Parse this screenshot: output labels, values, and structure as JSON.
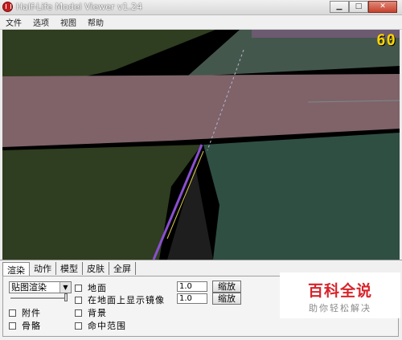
{
  "window": {
    "title": "Half-Life Model Viewer v1.24",
    "controls": {
      "minimize": "▁",
      "maximize": "□",
      "close": "✕"
    }
  },
  "menu": [
    "文件",
    "选项",
    "视图",
    "帮助"
  ],
  "viewport": {
    "fps": "60",
    "colors": {
      "background": "#000000",
      "green_dark": "#2f3d20",
      "pink": "#7f6369",
      "teal": "#2f4f43",
      "purple": "#8a4fd0",
      "fps": "#ffd400"
    }
  },
  "tabs": [
    "渲染",
    "动作",
    "模型",
    "皮肤",
    "全屏"
  ],
  "render_tab": {
    "render_mode": "贴图渲染",
    "checkboxes": {
      "ground": "地面",
      "mirror": "在地面上显示镜像",
      "background": "背景",
      "attachments": "附件",
      "bones": "骨骼",
      "hitboxes": "命中范围"
    },
    "scale_inputs": [
      "1.0",
      "1.0"
    ],
    "scale_button": "缩放"
  },
  "watermark": {
    "title": "百科全说",
    "subtitle": "助你轻松解决"
  }
}
